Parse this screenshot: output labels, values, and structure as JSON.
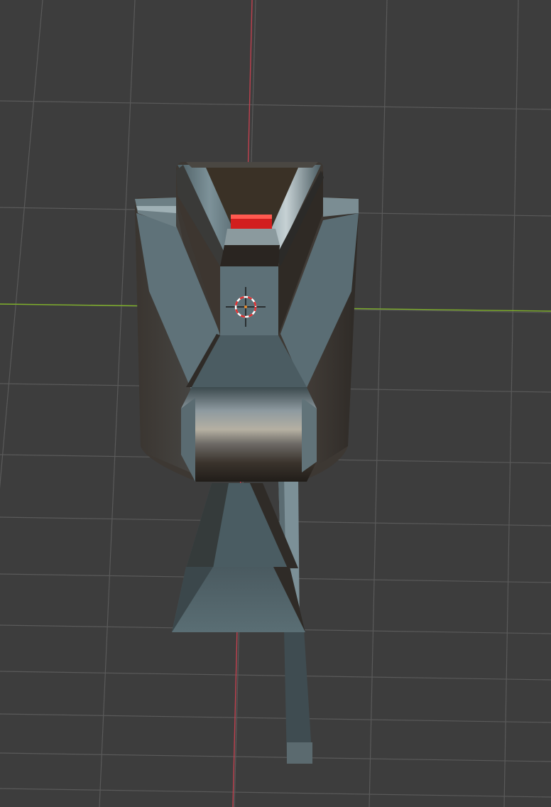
{
  "viewport": {
    "background": "#3d3d3d",
    "grid_color": "#5a5a5a",
    "x_axis_color": "#7fb02a",
    "y_axis_color": "#c0414f"
  },
  "object": {
    "colors": {
      "body_light": "#6b7d84",
      "body_mid": "#55666d",
      "body_dark": "#3a3530",
      "body_shadow": "#2a2622",
      "highlight": "#a8b6bc",
      "accent_red": "#d21e1e"
    }
  },
  "cursor_3d": {
    "ring_primary": "#e03030",
    "ring_secondary": "#ffffff",
    "crosshair": "#1a1a1a"
  }
}
